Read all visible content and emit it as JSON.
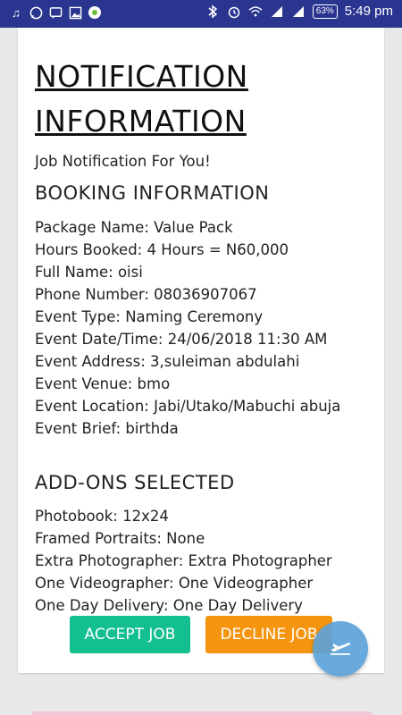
{
  "status_bar": {
    "time": "5:49 pm",
    "battery": "63%",
    "left_icons": [
      "music-icon",
      "whatsapp-icon",
      "message-icon",
      "image-icon",
      "app-icon"
    ],
    "right_icons": [
      "bluetooth-icon",
      "alarm-icon",
      "wifi-icon",
      "signal-icon",
      "signal-icon"
    ]
  },
  "heading": {
    "line1": "NOTIFICATION",
    "line2": "INFORMATION"
  },
  "subtitle": "Job Notification For You!",
  "booking": {
    "title": "BOOKING INFORMATION",
    "lines": [
      "Package Name: Value Pack",
      "Hours Booked: 4 Hours = N60,000",
      "Full Name: oisi",
      "Phone Number: 08036907067",
      "Event Type: Naming Ceremony",
      "Event Date/Time: 24/06/2018 11:30 AM",
      "Event Address: 3,suleiman abdulahi",
      "Event Venue: bmo",
      "Event Location: Jabi/Utako/Mabuchi abuja",
      "Event Brief: birthda"
    ]
  },
  "addons": {
    "title": "ADD-ONS SELECTED",
    "lines": [
      "Photobook: 12x24",
      "Framed Portraits: None",
      "Extra Photographer: Extra Photographer",
      "One Videographer: One Videographer",
      "One Day Delivery: One Day Delivery"
    ]
  },
  "actions": {
    "accept": "ACCEPT JOB",
    "decline": "DECLINE JOB"
  },
  "fab": {
    "icon": "airplane-icon"
  },
  "colors": {
    "status_bar": "#2a3590",
    "accept": "#13be8f",
    "decline": "#f5940f",
    "fab": "#5ea2d8"
  }
}
